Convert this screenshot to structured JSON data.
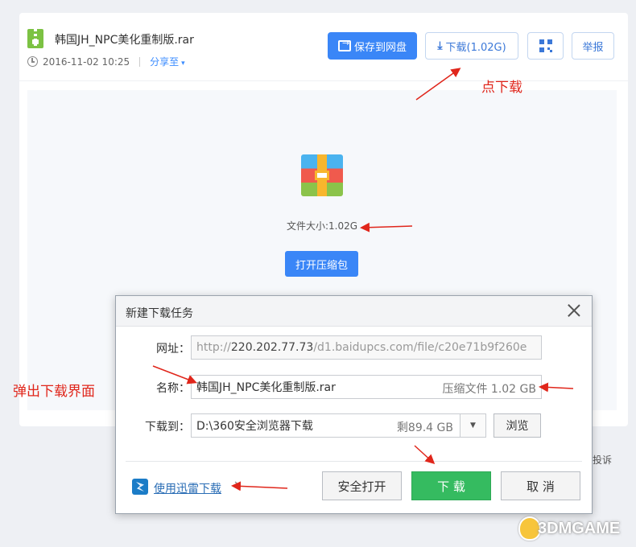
{
  "file": {
    "name": "韩国JH_NPC美化重制版.rar",
    "date": "2016-11-02 10:25",
    "share_label": "分享至",
    "size_label": "文件大小:1.02G"
  },
  "toolbar": {
    "save_label": "保存到网盘",
    "download_label": "下载(1.02G)",
    "report_label": "举报"
  },
  "preview": {
    "open_label": "打开压缩包"
  },
  "behind_text": "投诉",
  "dialog": {
    "title": "新建下载任务",
    "url_label": "网址：",
    "url_prefix": "http://",
    "url_host": "220.202.77.73",
    "url_rest": "/d1.baidupcs.com/file/c20e71b9f260e",
    "name_label": "名称：",
    "name_value": "韩国JH_NPC美化重制版.rar",
    "name_type": "压缩文件 1.02 GB",
    "path_label": "下载到：",
    "path_value": "D:\\360安全浏览器下载",
    "path_free": "剩89.4 GB",
    "browse_label": "浏览",
    "xunlei_label": "使用迅雷下载",
    "xunlei_close": "✕",
    "safe_open_label": "安全打开",
    "download_label": "下 载",
    "cancel_label": "取 消"
  },
  "annotations": {
    "click_download": "点下载",
    "popup_dialog": "弹出下载界面"
  },
  "watermark": "3DMGAME",
  "colors": {
    "primary": "#3a86f7",
    "green": "#35bb60",
    "annotation": "#e0261b"
  }
}
